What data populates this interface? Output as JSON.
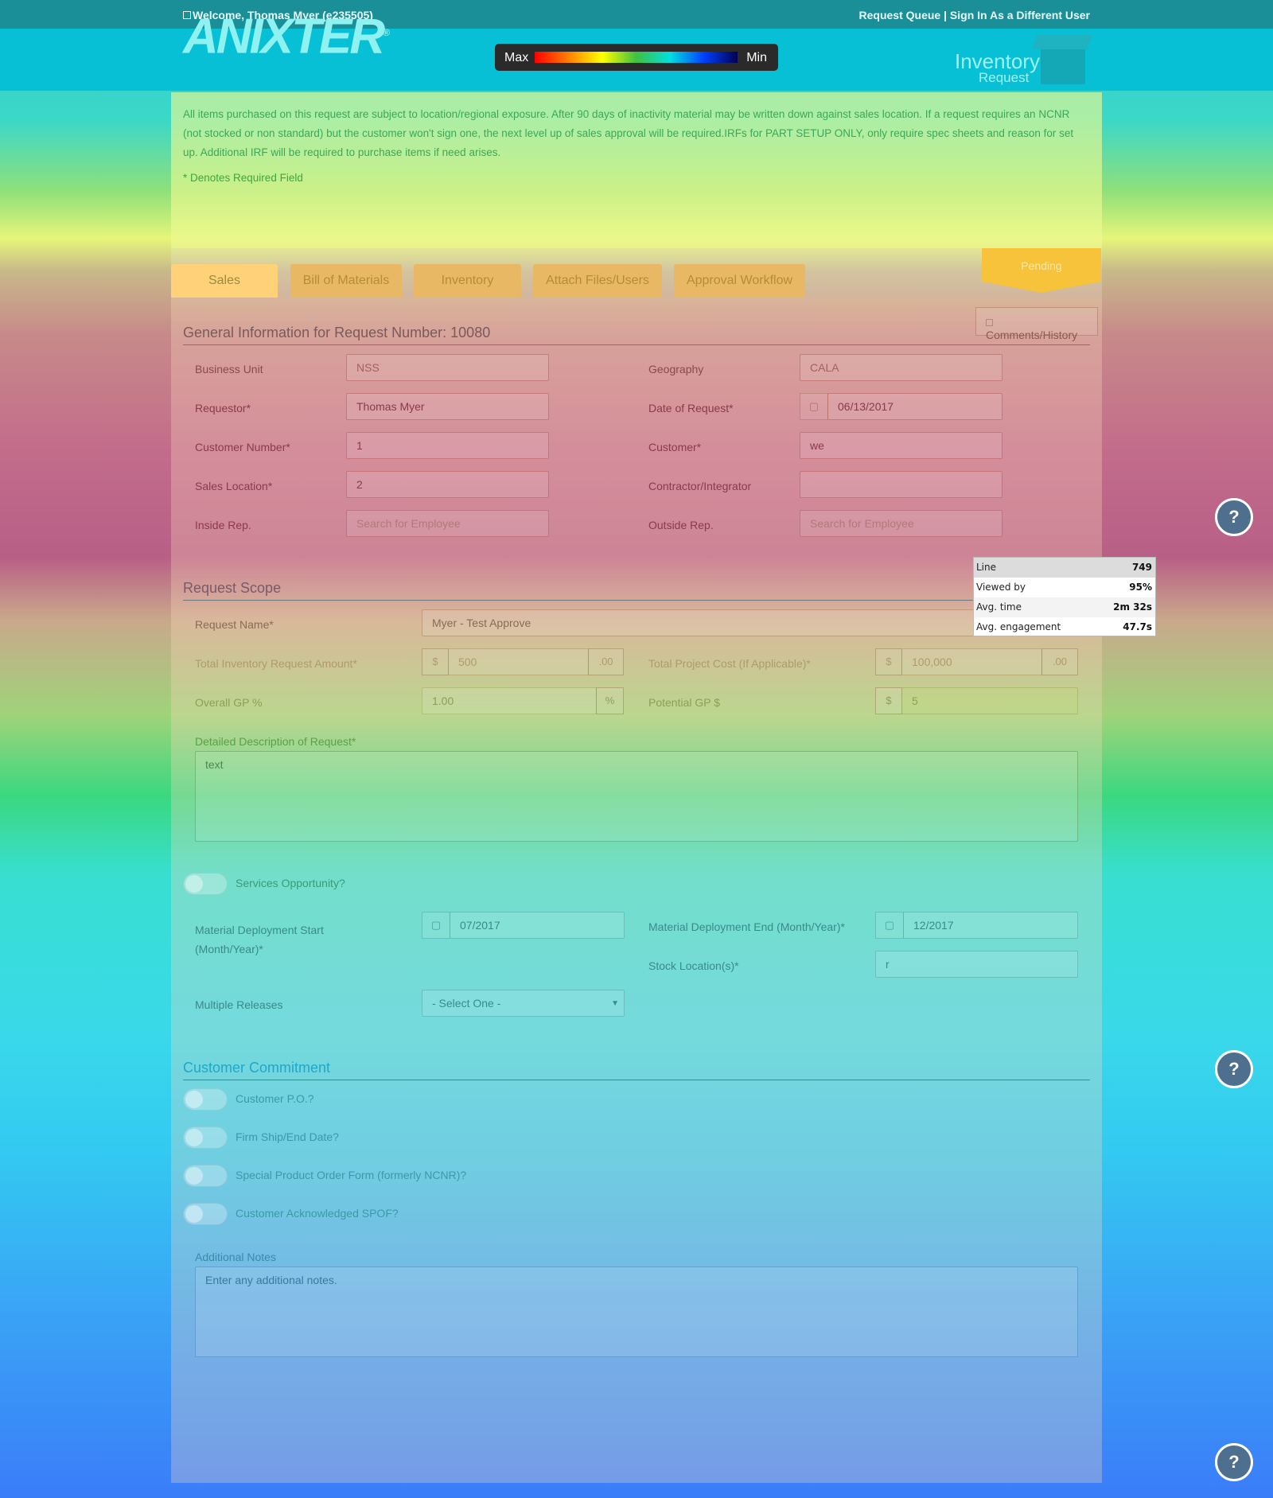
{
  "topbar": {
    "welcome": "Welcome, Thomas Myer (e235505)",
    "request_queue": "Request Queue",
    "separator": "|",
    "sign_in": "Sign In As a Different User"
  },
  "header": {
    "logo": "ANIXTER",
    "logo_mark": "®",
    "legend_max": "Max",
    "legend_min": "Min",
    "inventory_line1": "Inventory",
    "inventory_line2": "Request"
  },
  "intro": {
    "text": "All items purchased on this request are subject to location/regional exposure. After 90 days of inactivity material may be written down against sales location. If a request requires an NCNR (not stocked or non standard) but the customer won't sign one, the next level up of sales approval will be required.IRFs for PART SETUP ONLY, only require spec sheets and reason for set up. Additional IRF will be required to purchase items if need arises.",
    "required_note": "* Denotes Required Field"
  },
  "tabs": [
    "Sales",
    "Bill of Materials",
    "Inventory",
    "Attach Files/Users",
    "Approval Workflow"
  ],
  "status": "Pending",
  "comments_button": "Comments/History",
  "general": {
    "title": "General Information for Request Number: 10080",
    "business_unit": {
      "label": "Business Unit",
      "value": "NSS"
    },
    "geography": {
      "label": "Geography",
      "value": "CALA"
    },
    "requestor": {
      "label": "Requestor*",
      "value": "Thomas Myer"
    },
    "date": {
      "label": "Date of Request*",
      "value": "06/13/2017"
    },
    "customer_number": {
      "label": "Customer Number*",
      "value": "1"
    },
    "customer": {
      "label": "Customer*",
      "value": "we"
    },
    "sales_location": {
      "label": "Sales Location*",
      "value": "2"
    },
    "contractor": {
      "label": "Contractor/Integrator",
      "value": ""
    },
    "inside_rep": {
      "label": "Inside Rep.",
      "placeholder": "Search for Employee"
    },
    "outside_rep": {
      "label": "Outside Rep.",
      "placeholder": "Search for Employee"
    }
  },
  "scope": {
    "title": "Request Scope",
    "request_name": {
      "label": "Request Name*",
      "value": "Myer - Test Approve"
    },
    "total_inventory": {
      "label": "Total Inventory Request Amount*",
      "prefix": "$",
      "value": "500",
      "suffix": ".00"
    },
    "total_project": {
      "label": "Total Project Cost (If Applicable)*",
      "prefix": "$",
      "value": "100,000",
      "suffix": ".00"
    },
    "overall_gp": {
      "label": "Overall GP %",
      "value": "1.00",
      "suffix": "%"
    },
    "potential_gp": {
      "label": "Potential GP $",
      "prefix": "$",
      "value": "5"
    },
    "description": {
      "label": "Detailed Description of Request*",
      "value": "text"
    },
    "services": "Services Opportunity?",
    "deploy_start": {
      "label_line1": "Material Deployment Start",
      "label_line2": "(Month/Year)*",
      "value": "07/2017"
    },
    "deploy_end": {
      "label": "Material Deployment End (Month/Year)*",
      "value": "12/2017"
    },
    "stock_location": {
      "label": "Stock Location(s)*",
      "value": "r"
    },
    "multiple_releases": {
      "label": "Multiple Releases",
      "value": "- Select One -"
    }
  },
  "commitment": {
    "title": "Customer Commitment",
    "toggles": [
      "Customer P.O.?",
      "Firm Ship/End Date?",
      "Special Product Order Form (formerly NCNR)?",
      "Customer Acknowledged SPOF?"
    ],
    "notes_label": "Additional Notes",
    "notes_placeholder": "Enter any additional notes."
  },
  "tooltip": {
    "rows": [
      {
        "k": "Line",
        "v": "749"
      },
      {
        "k": "Viewed by",
        "v": "95%"
      },
      {
        "k": "Avg. time",
        "v": "2m 32s"
      },
      {
        "k": "Avg. engagement",
        "v": "47.7s"
      }
    ]
  },
  "help_label": "?",
  "icons": {
    "calendar": "calendar-icon",
    "user": "user-icon",
    "comment": "comment-icon",
    "caret": "caret-down-icon"
  }
}
